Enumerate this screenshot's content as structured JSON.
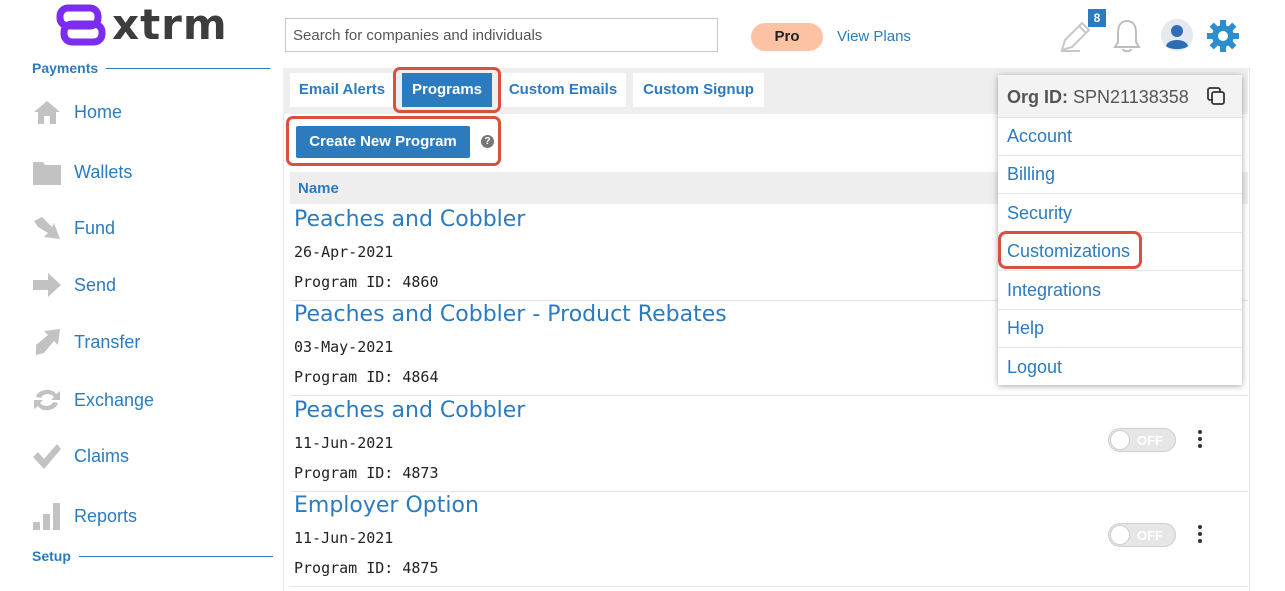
{
  "brand": {
    "logo_text": "xtrm",
    "logo_color": "#7b2cf0"
  },
  "colors": {
    "accent": "#2c7bbf",
    "highlight": "#d9503f",
    "pro_pill": "#fbc3a4"
  },
  "sidebar": {
    "payments_heading": "Payments",
    "setup_heading": "Setup",
    "items": [
      {
        "label": "Home",
        "icon": "home-icon"
      },
      {
        "label": "Wallets",
        "icon": "folder-icon"
      },
      {
        "label": "Fund",
        "icon": "fund-arrow-icon"
      },
      {
        "label": "Send",
        "icon": "send-arrow-icon"
      },
      {
        "label": "Transfer",
        "icon": "transfer-arrow-icon"
      },
      {
        "label": "Exchange",
        "icon": "exchange-icon"
      },
      {
        "label": "Claims",
        "icon": "checkmark-icon"
      },
      {
        "label": "Reports",
        "icon": "bar-chart-icon"
      }
    ]
  },
  "header": {
    "search_placeholder": "Search for companies and individuals",
    "plan_badge": "Pro",
    "view_plans": "View Plans",
    "notes_badge_count": "8"
  },
  "tabs": [
    {
      "label": "Email Alerts",
      "active": false
    },
    {
      "label": "Programs",
      "active": true
    },
    {
      "label": "Custom Emails",
      "active": false
    },
    {
      "label": "Custom Signup",
      "active": false
    }
  ],
  "actions": {
    "create_program": "Create New Program",
    "help_glyph": "?"
  },
  "table": {
    "column_name": "Name",
    "programs": [
      {
        "name": "Peaches and Cobbler",
        "date": "26-Apr-2021",
        "program_id": "Program ID: 4860"
      },
      {
        "name": "Peaches and Cobbler - Product Rebates",
        "date": "03-May-2021",
        "program_id": "Program ID: 4864"
      },
      {
        "name": "Peaches and Cobbler",
        "date": "11-Jun-2021",
        "program_id": "Program ID: 4873",
        "status": "OFF"
      },
      {
        "name": "Employer Option",
        "date": "11-Jun-2021",
        "program_id": "Program ID: 4875",
        "status": "OFF"
      }
    ]
  },
  "account_menu": {
    "org_label": "Org ID:",
    "org_value": "SPN21138358",
    "items": [
      "Account",
      "Billing",
      "Security",
      "Customizations",
      "Integrations",
      "Help",
      "Logout"
    ],
    "highlighted_item": "Customizations"
  }
}
